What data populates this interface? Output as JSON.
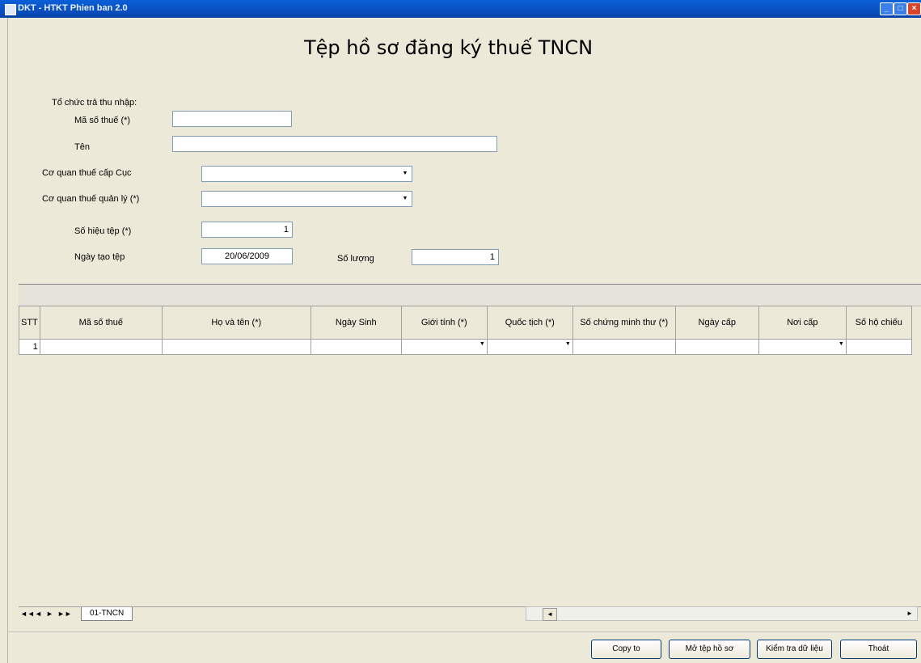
{
  "window": {
    "title": "DKT - HTKT Phien ban 2.0",
    "min": "_",
    "max": "□",
    "close": "×"
  },
  "heading": "Tệp hồ sơ đăng ký thuế TNCN",
  "form": {
    "org_label": "Tổ chức trả thu nhập:",
    "tax_code_label": "Mã số thuế (*)",
    "tax_code_value": "",
    "name_label": "Tên",
    "name_value": "",
    "dept_label": "Cơ quan thuế cấp Cục",
    "dept_value": "",
    "mgr_label": "Cơ quan thuế quản lý (*)",
    "mgr_value": "",
    "file_no_label": "Số hiệu tệp (*)",
    "file_no_value": "1",
    "date_label": "Ngày tạo tệp",
    "date_value": "20/06/2009",
    "qty_label": "Số lượng",
    "qty_value": "1"
  },
  "grid": {
    "headers": [
      "STT",
      "Mã số thuế",
      "Họ và tên (*)",
      "Ngày Sinh",
      "Giới tính (*)",
      "Quốc tịch (*)",
      "Số chứng minh thư (*)",
      "Ngày cấp",
      "Nơi cấp",
      "Số hộ chiếu"
    ],
    "row1_stt": "1"
  },
  "sheet": {
    "nav_first": "◄◄",
    "nav_prev": "◄",
    "nav_next": "►",
    "nav_last": "►►",
    "tab": "01-TNCN"
  },
  "buttons": {
    "copy": "Copy to",
    "open": "Mở tệp hồ sơ",
    "check": "Kiểm tra dữ liệu",
    "exit": "Thoát"
  },
  "icons": {
    "dropdown": "▼",
    "scroll_left": "◄",
    "scroll_right": "►"
  }
}
